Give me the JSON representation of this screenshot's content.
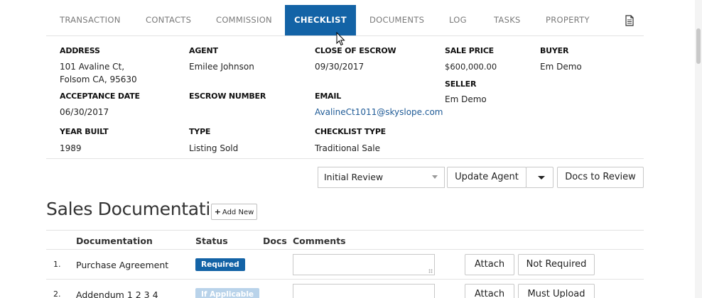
{
  "tabs": [
    {
      "label": "TRANSACTION"
    },
    {
      "label": "CONTACTS"
    },
    {
      "label": "COMMISSION"
    },
    {
      "label": "CHECKLIST",
      "active": true
    },
    {
      "label": "DOCUMENTS"
    },
    {
      "label": "LOG"
    },
    {
      "label": "TASKS"
    },
    {
      "label": "PROPERTY"
    }
  ],
  "tab_icon": "document-icon",
  "details": {
    "address_label": "ADDRESS",
    "address_line1": "101 Avaline Ct,",
    "address_line2": "Folsom CA, 95630",
    "agent_label": "AGENT",
    "agent_value": "Emilee Johnson",
    "close_label": "CLOSE OF ESCROW",
    "close_value": "09/30/2017",
    "sale_price_label": "SALE PRICE",
    "sale_price_value": "$600,000.00",
    "buyer_label": "BUYER",
    "buyer_value": "Em Demo",
    "seller_label": "SELLER",
    "seller_value": "Em Demo",
    "acceptance_label": "ACCEPTANCE DATE",
    "acceptance_value": "06/30/2017",
    "escrow_label": "ESCROW NUMBER",
    "email_label": "EMAIL",
    "email_value": "AvalineCt1011@skyslope.com",
    "year_label": "YEAR BUILT",
    "year_value": "1989",
    "type_label": "TYPE",
    "type_value": "Listing Sold",
    "checklist_type_label": "CHECKLIST TYPE",
    "checklist_type_value": "Traditional Sale"
  },
  "actions": {
    "review_select_value": "Initial Review",
    "update_agent_label": "Update Agent",
    "docs_to_review_label": "Docs to Review"
  },
  "section": {
    "title": "Sales Documentation",
    "add_new_label": "Add New"
  },
  "table": {
    "headers": {
      "documentation": "Documentation",
      "status": "Status",
      "docs": "Docs",
      "comments": "Comments"
    },
    "rows": [
      {
        "num": "1.",
        "name": "Purchase Agreement",
        "status": "Required",
        "status_color": "#1363a6",
        "btn1": "Attach",
        "btn2": "Not Required"
      },
      {
        "num": "2.",
        "name": "Addendum 1 2 3 4",
        "status": "If Applicable",
        "status_color": "#b9d3ea",
        "btn1": "Attach",
        "btn2": "Must Upload"
      }
    ]
  },
  "colors": {
    "accent": "#1363a6",
    "link": "#1e5a96"
  }
}
